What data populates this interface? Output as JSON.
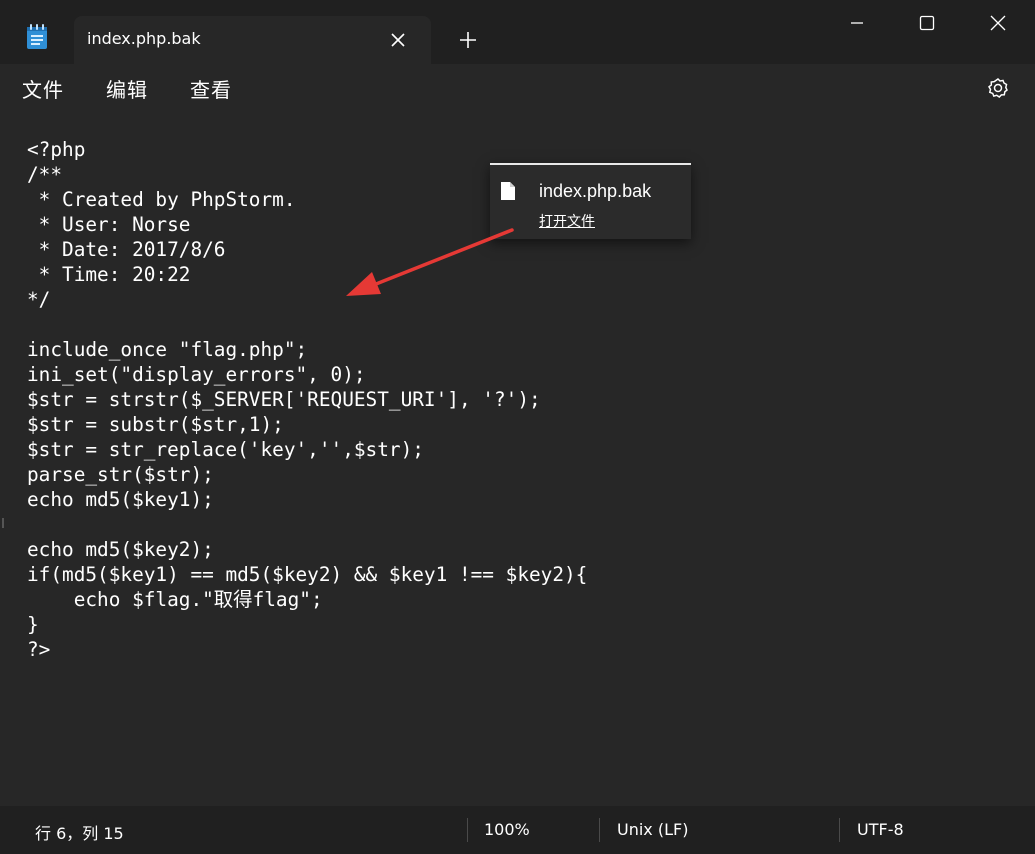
{
  "window": {
    "tab_title": "index.php.bak",
    "icons": {
      "app": "notepad-icon",
      "tab_close": "close-icon",
      "new_tab": "plus-icon",
      "minimize": "minimize-icon",
      "maximize": "maximize-icon",
      "close": "close-icon"
    }
  },
  "menu": {
    "file": "文件",
    "edit": "编辑",
    "view": "查看",
    "settings_icon": "gear-icon"
  },
  "editor": {
    "lines": [
      "<?php",
      "/**",
      " * Created by PhpStorm.",
      " * User: Norse",
      " * Date: 2017/8/6",
      " * Time: 20:22",
      "*/",
      "",
      "include_once \"flag.php\";",
      "ini_set(\"display_errors\", 0);",
      "$str = strstr($_SERVER['REQUEST_URI'], '?');",
      "$str = substr($str,1);",
      "$str = str_replace('key','',$str);",
      "parse_str($str);",
      "echo md5($key1);",
      "",
      "echo md5($key2);",
      "if(md5($key1) == md5($key2) && $key1 !== $key2){",
      "    echo $flag.\"取得flag\";",
      "}",
      "?>"
    ]
  },
  "popup": {
    "file_name": "index.php.bak",
    "open_label": "打开文件",
    "icon": "file-icon"
  },
  "annotation": {
    "color": "#e53935"
  },
  "status": {
    "position": "行 6，列 15",
    "zoom": "100%",
    "line_ending": "Unix (LF)",
    "encoding": "UTF-8"
  }
}
